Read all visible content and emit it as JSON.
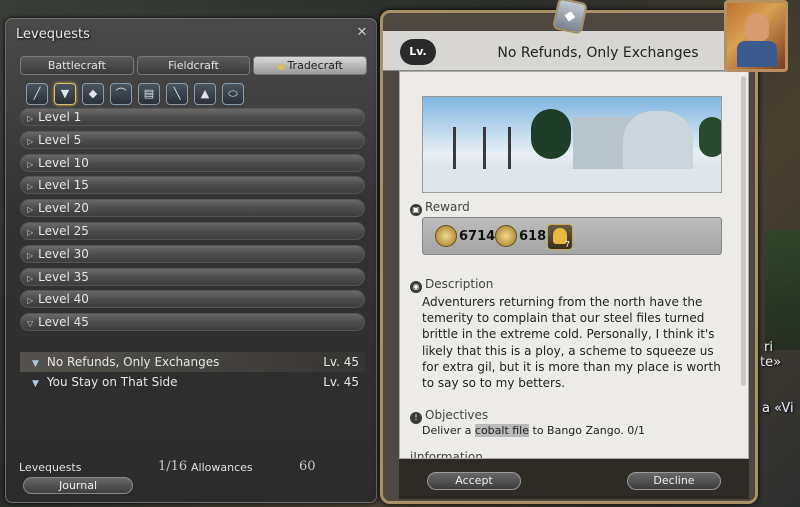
{
  "leve_panel": {
    "title": "Levequests",
    "close_icon": "close-icon",
    "tabs": [
      {
        "label": "Battlecraft",
        "active": false
      },
      {
        "label": "Fieldcraft",
        "active": false
      },
      {
        "label": "Tradecraft",
        "active": true
      }
    ],
    "class_icons": [
      {
        "name": "carpenter-icon",
        "glyph": "╱"
      },
      {
        "name": "blacksmith-icon",
        "glyph": "▼"
      },
      {
        "name": "armorer-icon",
        "glyph": "◆"
      },
      {
        "name": "goldsmith-icon",
        "glyph": "⌒"
      },
      {
        "name": "leatherworker-icon",
        "glyph": "▤"
      },
      {
        "name": "weaver-icon",
        "glyph": "╲"
      },
      {
        "name": "alchemist-icon",
        "glyph": "▲"
      },
      {
        "name": "culinarian-icon",
        "glyph": "⬭"
      }
    ],
    "levels": [
      "Level 1",
      "Level 5",
      "Level 10",
      "Level 15",
      "Level 20",
      "Level 25",
      "Level 30",
      "Level 35",
      "Level 40",
      "Level 45"
    ],
    "expanded_level": "Level 45",
    "quests": [
      {
        "name": "No Refunds, Only Exchanges",
        "level": "Lv. 45",
        "selected": true
      },
      {
        "name": "You Stay on That Side",
        "level": "Lv. 45",
        "selected": false
      }
    ],
    "footer": {
      "levequests_label": "Levequests",
      "levequests_count": "1/16",
      "allowances_label": "Allowances",
      "allowances_value": "60",
      "journal_label": "Journal"
    }
  },
  "detail": {
    "level_badge": "Lv. 45",
    "title": "No Refunds, Only Exchanges",
    "reward_heading": "Reward",
    "rewards": {
      "exp": "67146",
      "gil": "618",
      "item_qty": "7"
    },
    "description_heading": "Description",
    "description": "Adventurers returning from the north have the temerity to complain that our steel files turned brittle in the extreme cold. Personally, I think it's likely that this is a ploy, a scheme to squeeze us for extra gil, but it is more than my place is worth to say so to my betters.",
    "objectives_heading": "Objectives",
    "objective_prefix": "Deliver a ",
    "objective_item": "cobalt file",
    "objective_suffix": " to Bango Zango. 0/1",
    "information_heading": "Information",
    "accept_label": "Accept",
    "decline_label": "Decline"
  },
  "background": {
    "text1": "ri",
    "text2": "te»",
    "text3": "a «Vi"
  }
}
